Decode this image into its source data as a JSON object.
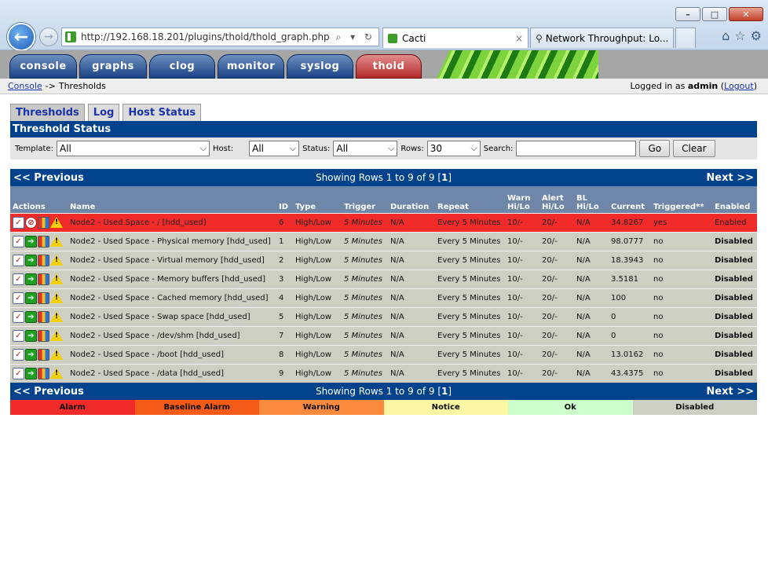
{
  "browser": {
    "url": "http://192.168.18.201/plugins/thold/thold_graph.php",
    "address_tools": "⌕ ▾ ↻",
    "tabs": [
      {
        "label": "Cacti",
        "close": "×"
      },
      {
        "label": "Network Throughput: Lo..."
      }
    ],
    "window_buttons": {
      "minimize": "–",
      "maximize": "□",
      "close": "✕"
    },
    "toolbar_icons": {
      "home": "⌂",
      "favorites": "☆",
      "settings": "⚙"
    }
  },
  "cacti_tabs": [
    "console",
    "graphs",
    "clog",
    "monitor",
    "syslog",
    "thold"
  ],
  "breadcrumb": {
    "root": "Console",
    "separator": "->",
    "current": "Thresholds"
  },
  "login": {
    "prefix": "Logged in as",
    "user": "admin",
    "logout": "Logout"
  },
  "subtabs": [
    "Thresholds",
    "Log",
    "Host Status"
  ],
  "section_title": "Threshold Status",
  "filters": {
    "template_label": "Template:",
    "template_value": "All",
    "host_label": "Host:",
    "host_value": "All",
    "status_label": "Status:",
    "status_value": "All",
    "rows_label": "Rows:",
    "rows_value": "30",
    "search_label": "Search:",
    "search_value": "",
    "go": "Go",
    "clear": "Clear"
  },
  "pager": {
    "previous": "<< Previous",
    "next": "Next >>",
    "showing": "Showing Rows 1 to 9 of 9 [",
    "page": "1",
    "close_bracket": "]"
  },
  "columns": [
    "Actions",
    "Name",
    "ID",
    "Type",
    "Trigger",
    "Duration",
    "Repeat",
    "Warn Hi/Lo",
    "Alert Hi/Lo",
    "BL Hi/Lo",
    "Current",
    "Triggered**",
    "Enabled"
  ],
  "rows": [
    {
      "status": "alarm",
      "name": "Node2 - Used Space - / [hdd_used]",
      "id": "6",
      "type": "High/Low",
      "trigger": "5 Minutes",
      "duration": "N/A",
      "repeat": "Every 5 Minutes",
      "warn": "10/-",
      "alert": "20/-",
      "bl": "N/A",
      "current": "34.8267",
      "triggered": "yes",
      "enabled": "Enabled"
    },
    {
      "status": "disabled",
      "name": "Node2 - Used Space - Physical memory [hdd_used]",
      "id": "1",
      "type": "High/Low",
      "trigger": "5 Minutes",
      "duration": "N/A",
      "repeat": "Every 5 Minutes",
      "warn": "10/-",
      "alert": "20/-",
      "bl": "N/A",
      "current": "98.0777",
      "triggered": "no",
      "enabled": "Disabled"
    },
    {
      "status": "disabled",
      "name": "Node2 - Used Space - Virtual memory [hdd_used]",
      "id": "2",
      "type": "High/Low",
      "trigger": "5 Minutes",
      "duration": "N/A",
      "repeat": "Every 5 Minutes",
      "warn": "10/-",
      "alert": "20/-",
      "bl": "N/A",
      "current": "18.3943",
      "triggered": "no",
      "enabled": "Disabled"
    },
    {
      "status": "disabled",
      "name": "Node2 - Used Space - Memory buffers [hdd_used]",
      "id": "3",
      "type": "High/Low",
      "trigger": "5 Minutes",
      "duration": "N/A",
      "repeat": "Every 5 Minutes",
      "warn": "10/-",
      "alert": "20/-",
      "bl": "N/A",
      "current": "3.5181",
      "triggered": "no",
      "enabled": "Disabled"
    },
    {
      "status": "disabled",
      "name": "Node2 - Used Space - Cached memory [hdd_used]",
      "id": "4",
      "type": "High/Low",
      "trigger": "5 Minutes",
      "duration": "N/A",
      "repeat": "Every 5 Minutes",
      "warn": "10/-",
      "alert": "20/-",
      "bl": "N/A",
      "current": "100",
      "triggered": "no",
      "enabled": "Disabled"
    },
    {
      "status": "disabled",
      "name": "Node2 - Used Space - Swap space [hdd_used]",
      "id": "5",
      "type": "High/Low",
      "trigger": "5 Minutes",
      "duration": "N/A",
      "repeat": "Every 5 Minutes",
      "warn": "10/-",
      "alert": "20/-",
      "bl": "N/A",
      "current": "0",
      "triggered": "no",
      "enabled": "Disabled"
    },
    {
      "status": "disabled",
      "name": "Node2 - Used Space - /dev/shm [hdd_used]",
      "id": "7",
      "type": "High/Low",
      "trigger": "5 Minutes",
      "duration": "N/A",
      "repeat": "Every 5 Minutes",
      "warn": "10/-",
      "alert": "20/-",
      "bl": "N/A",
      "current": "0",
      "triggered": "no",
      "enabled": "Disabled"
    },
    {
      "status": "disabled",
      "name": "Node2 - Used Space - /boot [hdd_used]",
      "id": "8",
      "type": "High/Low",
      "trigger": "5 Minutes",
      "duration": "N/A",
      "repeat": "Every 5 Minutes",
      "warn": "10/-",
      "alert": "20/-",
      "bl": "N/A",
      "current": "13.0162",
      "triggered": "no",
      "enabled": "Disabled"
    },
    {
      "status": "disabled",
      "name": "Node2 - Used Space - /data [hdd_used]",
      "id": "9",
      "type": "High/Low",
      "trigger": "5 Minutes",
      "duration": "N/A",
      "repeat": "Every 5 Minutes",
      "warn": "10/-",
      "alert": "20/-",
      "bl": "N/A",
      "current": "43.4375",
      "triggered": "no",
      "enabled": "Disabled"
    }
  ],
  "legend": [
    {
      "label": "Alarm",
      "color": "#f12a2a"
    },
    {
      "label": "Baseline Alarm",
      "color": "#f45a18"
    },
    {
      "label": "Warning",
      "color": "#fb8a3c"
    },
    {
      "label": "Notice",
      "color": "#fbf7a3"
    },
    {
      "label": "Ok",
      "color": "#ccffcc"
    },
    {
      "label": "Disabled",
      "color": "#cdcec4"
    }
  ],
  "icons": {
    "edit": "edit-icon",
    "enable": "enable-icon",
    "disable": "disable-icon",
    "graph": "graph-icon",
    "warning": "warning-icon"
  }
}
